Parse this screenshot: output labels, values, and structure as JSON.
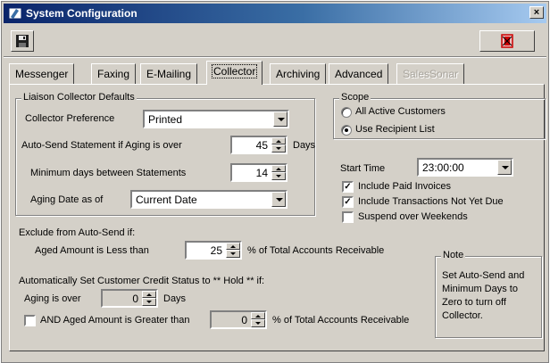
{
  "window": {
    "title": "System Configuration",
    "close_glyph": "×",
    "title_gradient_start": "#0a246a",
    "title_gradient_end": "#a6caf0",
    "face_color": "#d4d0c8"
  },
  "toolbar": {
    "save_icon": "floppy-disk-icon",
    "exit_icon": "exit-door-icon",
    "exit_icon_color": "#cc0000"
  },
  "tabs": [
    {
      "label": "Messenger",
      "active": false,
      "enabled": true
    },
    {
      "label": "Faxing",
      "active": false,
      "enabled": true
    },
    {
      "label": "E-Mailing",
      "active": false,
      "enabled": true
    },
    {
      "label": "Collector",
      "active": true,
      "enabled": true
    },
    {
      "label": "Archiving",
      "active": false,
      "enabled": true
    },
    {
      "label": "Advanced",
      "active": false,
      "enabled": true
    },
    {
      "label": "SalesSonar",
      "active": false,
      "enabled": false
    }
  ],
  "defaults": {
    "legend": "Liaison Collector Defaults",
    "collector_preference_label": "Collector Preference",
    "collector_preference_value": "Printed",
    "auto_send_label": "Auto-Send Statement if Aging is over",
    "auto_send_value": "45",
    "auto_send_unit": "Days",
    "min_days_label": "Minimum days between Statements",
    "min_days_value": "14",
    "aging_date_label": "Aging Date as of",
    "aging_date_value": "Current Date"
  },
  "scope": {
    "legend": "Scope",
    "option_all": "All Active Customers",
    "option_recipient": "Use Recipient List",
    "selected": "option_recipient"
  },
  "schedule": {
    "start_time_label": "Start Time",
    "start_time_value": "23:00:00",
    "include_paid_label": "Include Paid Invoices",
    "include_paid_checked": true,
    "include_not_due_label": "Include Transactions Not Yet Due",
    "include_not_due_checked": true,
    "suspend_weekends_label": "Suspend over Weekends",
    "suspend_weekends_checked": false
  },
  "exclude": {
    "heading": "Exclude from Auto-Send if:",
    "aged_less_label": "Aged Amount is Less than",
    "aged_less_value": "25",
    "aged_less_suffix": "% of Total Accounts Receivable"
  },
  "hold": {
    "heading": "Automatically Set Customer Credit Status to ** Hold ** if:",
    "aging_over_label": "Aging is over",
    "aging_over_value": "0",
    "aging_over_unit": "Days",
    "and_aged_label": "AND Aged Amount is Greater than",
    "and_aged_checked": false,
    "and_aged_value": "0",
    "and_aged_suffix": "% of Total Accounts Receivable"
  },
  "note": {
    "legend": "Note",
    "text": "Set Auto-Send and Minimum Days to Zero to turn off Collector."
  }
}
